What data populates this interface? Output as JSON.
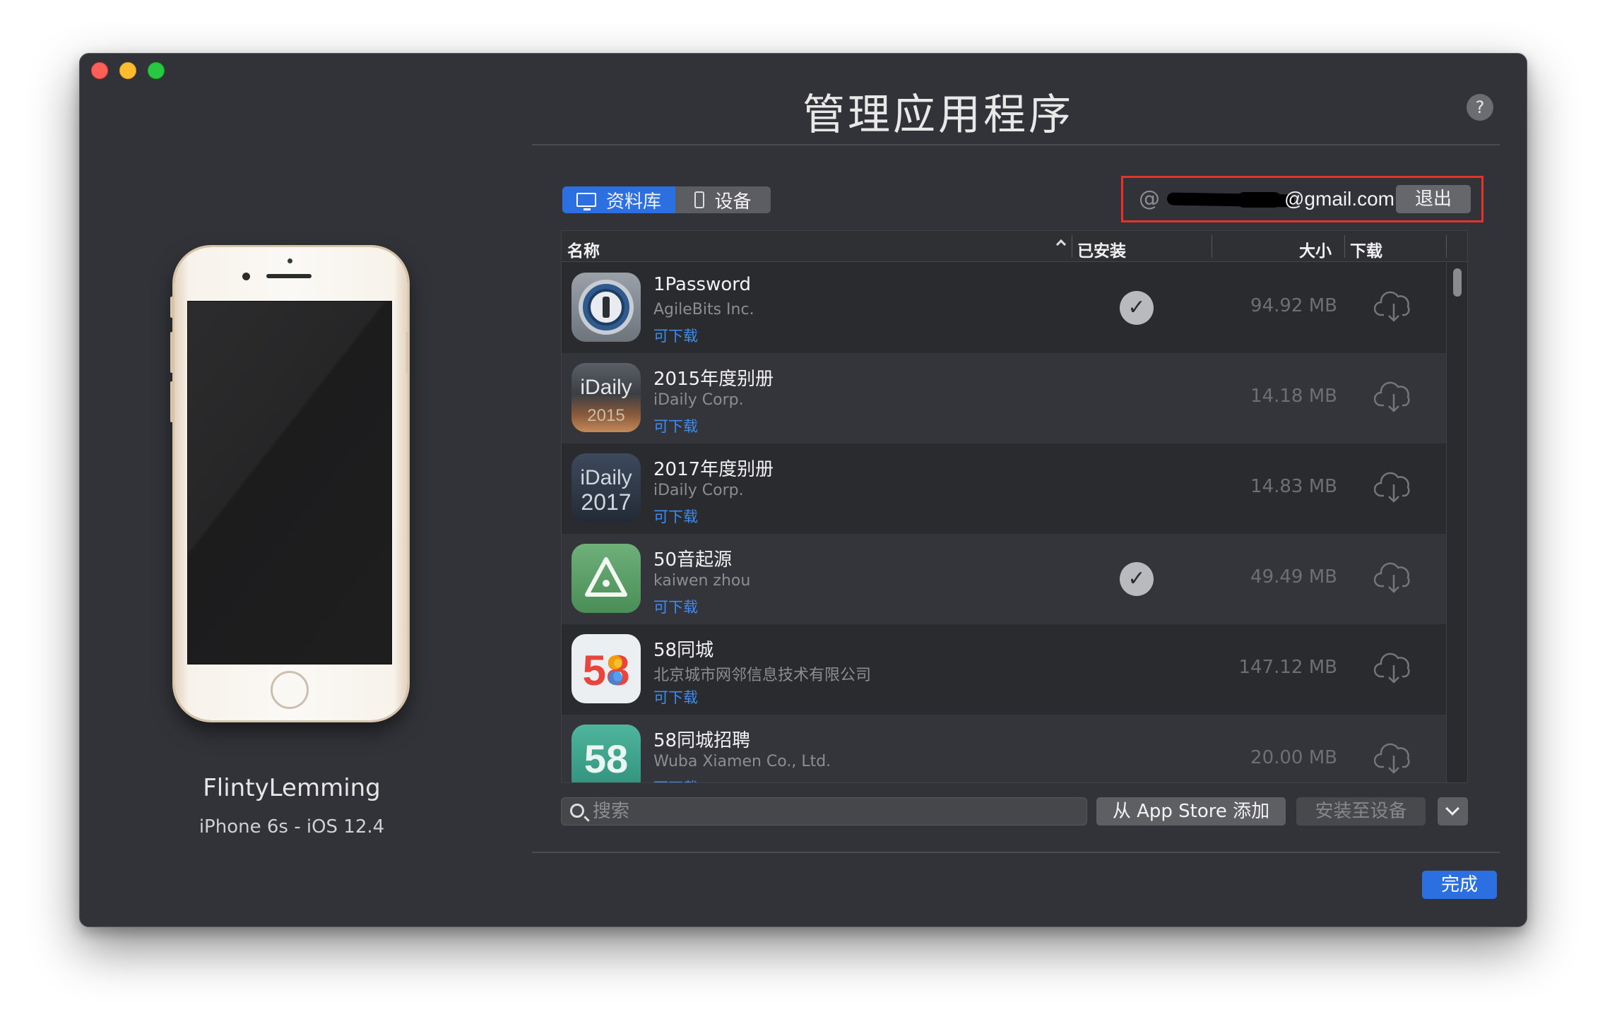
{
  "window": {
    "title": "管理应用程序",
    "help_label": "?"
  },
  "device": {
    "name": "FlintyLemming",
    "model": "iPhone 6s - iOS 12.4"
  },
  "segmented": {
    "library_label": "资料库",
    "device_label": "设备",
    "active": "资料库"
  },
  "account": {
    "at_sign": "@",
    "email_visible": "@gmail.com",
    "logout_label": "退出"
  },
  "table": {
    "columns": {
      "name": "名称",
      "installed": "已安装",
      "size": "大小",
      "download": "下载"
    },
    "rows": [
      {
        "name": "1Password",
        "developer": "AgileBits Inc.",
        "availability": "可下载",
        "installed": true,
        "size": "94.92 MB",
        "icon": "1password-icon"
      },
      {
        "name": "2015年度别册",
        "developer": "iDaily Corp.",
        "availability": "可下载",
        "installed": false,
        "size": "14.18 MB",
        "icon": "idaily-2015-icon",
        "icon_text_top": "iDaily",
        "icon_text_bottom": "2015"
      },
      {
        "name": "2017年度别册",
        "developer": "iDaily Corp.",
        "availability": "可下载",
        "installed": false,
        "size": "14.83 MB",
        "icon": "idaily-2017-icon",
        "icon_text_top": "iDaily",
        "icon_text_bottom": "2017"
      },
      {
        "name": "50音起源",
        "developer": "kaiwen zhou",
        "availability": "可下载",
        "installed": true,
        "size": "49.49 MB",
        "icon": "50-origin-icon"
      },
      {
        "name": "58同城",
        "developer": "北京城市网邻信息技术有限公司",
        "availability": "可下载",
        "installed": false,
        "size": "147.12 MB",
        "icon": "58-tongcheng-icon",
        "icon_text": "58"
      },
      {
        "name": "58同城招聘",
        "developer": "Wuba Xiamen Co., Ltd.",
        "availability": "可下载",
        "installed": false,
        "size": "20.00 MB",
        "icon": "58-recruit-icon",
        "icon_text": "58"
      }
    ]
  },
  "footer": {
    "search_placeholder": "搜索",
    "add_from_store_label": "从 App Store 添加",
    "install_to_device_label": "安装至设备",
    "done_label": "完成"
  },
  "colors": {
    "accent": "#2b6fe0",
    "highlight_box": "#e2342a",
    "window_bg": "#313338"
  }
}
